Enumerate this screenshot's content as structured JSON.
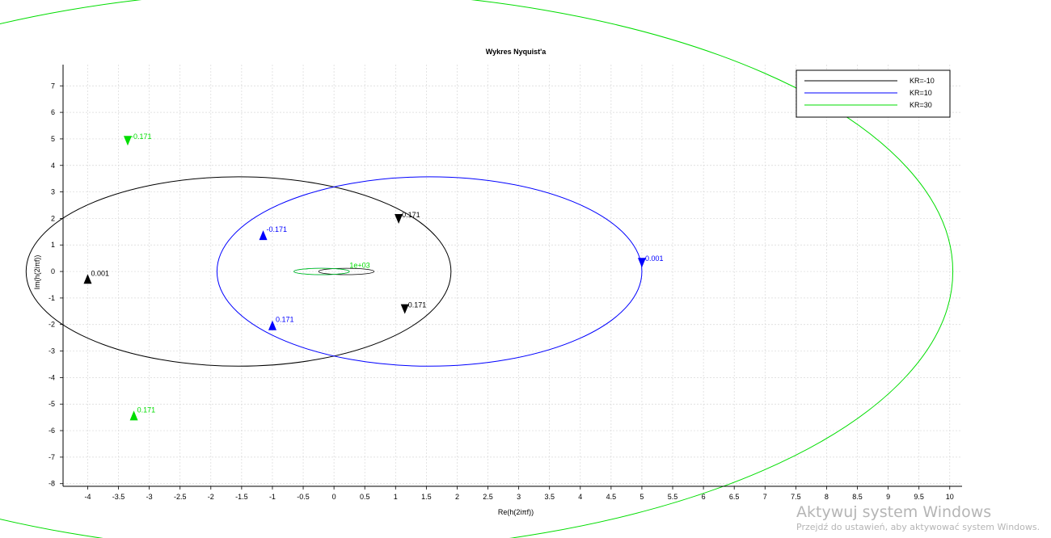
{
  "chart_data": {
    "type": "line",
    "title": "Wykres Nyquist'a",
    "xlabel": "Re(h(2iπf))",
    "ylabel": "Im(h(2iπf))",
    "xlim": [
      -4.4,
      10.2
    ],
    "ylim": [
      -8.1,
      7.8
    ],
    "grid": true,
    "legend_position": "top-right",
    "xticks": [
      "-4",
      "-3.5",
      "-3",
      "-2.5",
      "-2",
      "-1.5",
      "-1",
      "-0.5",
      "0",
      "0.5",
      "1",
      "1.5",
      "2",
      "2.5",
      "3",
      "3.5",
      "4",
      "4.5",
      "5",
      "5.5",
      "6",
      "6.5",
      "7",
      "7.5",
      "8",
      "8.5",
      "9",
      "9.5",
      "10"
    ],
    "yticks": [
      "-8",
      "-7",
      "-6",
      "-5",
      "-4",
      "-3",
      "-2",
      "-1",
      "0",
      "1",
      "2",
      "3",
      "4",
      "5",
      "6",
      "7"
    ],
    "series": [
      {
        "name": "KR=-10",
        "color": "#000000",
        "shape": "nyquist_loop",
        "center": [
          -1.55,
          0
        ],
        "radius_x": 3.45,
        "radius_y": 3.57,
        "inner_loop_center": [
          0.2,
          0
        ],
        "markers": [
          {
            "x": -4.0,
            "y": -0.25,
            "label": "0.001",
            "dir": "up"
          },
          {
            "x": 1.05,
            "y": 1.95,
            "label": "0.171",
            "dir": "down"
          },
          {
            "x": 1.15,
            "y": -1.45,
            "label": "0.171",
            "dir": "down"
          }
        ]
      },
      {
        "name": "KR=10",
        "color": "#0000ff",
        "shape": "nyquist_loop",
        "center": [
          1.55,
          0
        ],
        "radius_x": 3.45,
        "radius_y": 3.57,
        "inner_loop_center": [
          -0.2,
          0
        ],
        "markers": [
          {
            "x": 5.0,
            "y": 0.3,
            "label": "0.001",
            "dir": "down"
          },
          {
            "x": -1.15,
            "y": 1.4,
            "label": "-0.171",
            "dir": "up"
          },
          {
            "x": -1.0,
            "y": -2.0,
            "label": "0.171",
            "dir": "up"
          }
        ]
      },
      {
        "name": "KR=30",
        "color": "#00dd00",
        "shape": "nyquist_loop",
        "center": [
          -0.45,
          0
        ],
        "radius_x": 10.5,
        "radius_y": 10.6,
        "inner_loop_center": [
          -0.2,
          0
        ],
        "markers": [
          {
            "x": -3.35,
            "y": 4.9,
            "label": "-0.171",
            "dir": "down"
          },
          {
            "x": -3.25,
            "y": -5.4,
            "label": "0.171",
            "dir": "up"
          },
          {
            "x": 0.2,
            "y": 0.05,
            "label": "1e+03",
            "dir": "none"
          }
        ]
      }
    ]
  },
  "watermark": {
    "title": "Aktywuj system Windows",
    "subtitle": "Przejdź do ustawień, aby aktywować system Windows."
  }
}
